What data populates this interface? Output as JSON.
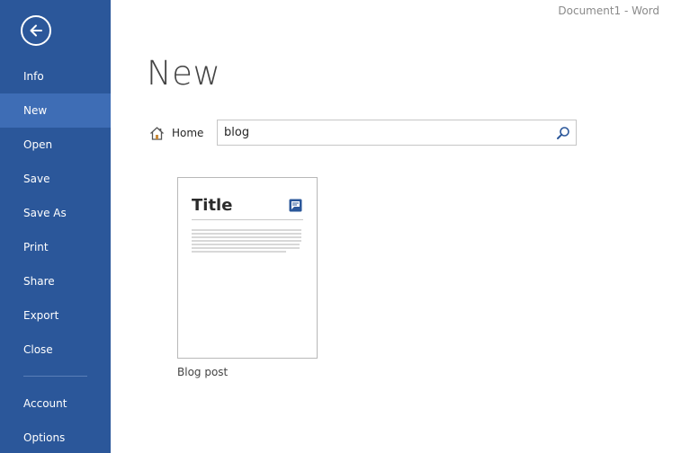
{
  "window": {
    "title": "Document1 - Word"
  },
  "sidebar": {
    "back_icon": "back-arrow-icon",
    "items": [
      {
        "label": "Info",
        "selected": false
      },
      {
        "label": "New",
        "selected": true
      },
      {
        "label": "Open",
        "selected": false
      },
      {
        "label": "Save",
        "selected": false
      },
      {
        "label": "Save As",
        "selected": false
      },
      {
        "label": "Print",
        "selected": false
      },
      {
        "label": "Share",
        "selected": false
      },
      {
        "label": "Export",
        "selected": false
      },
      {
        "label": "Close",
        "selected": false
      }
    ],
    "footer_items": [
      {
        "label": "Account"
      },
      {
        "label": "Options"
      }
    ],
    "color": "#2b579a",
    "selected_color": "#3e6db5"
  },
  "main": {
    "title": "New",
    "home_label": "Home",
    "home_icon": "home-icon",
    "search": {
      "value": "blog",
      "icon": "search-icon"
    },
    "templates": [
      {
        "heading": "Title",
        "caption": "Blog post",
        "badge_icon": "blog-badge-icon"
      }
    ]
  }
}
